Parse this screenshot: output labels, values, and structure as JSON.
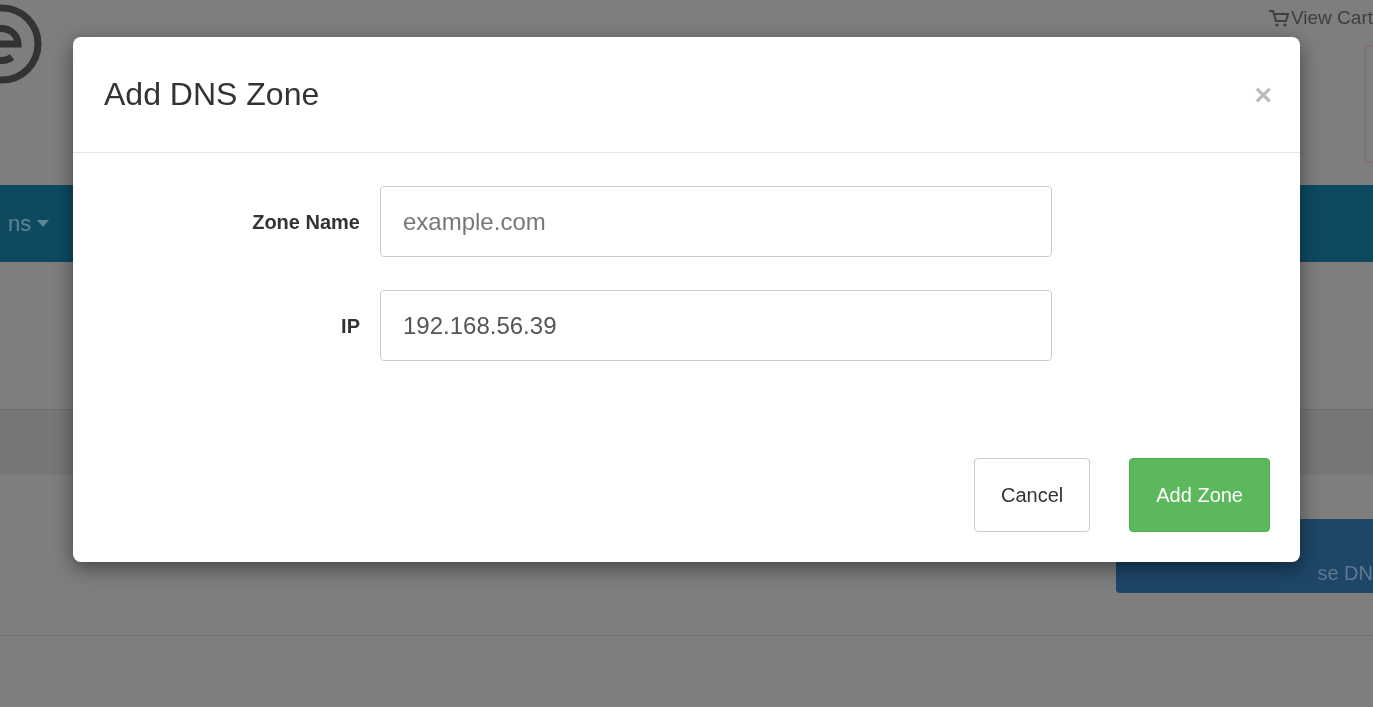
{
  "header": {
    "cart_link": "View Cart"
  },
  "navbar": {
    "menu_label": "ns"
  },
  "page": {
    "action_button": "se DN"
  },
  "modal": {
    "title": "Add DNS Zone",
    "close": "×",
    "fields": [
      {
        "label": "Zone Name",
        "placeholder": "example.com"
      },
      {
        "label": "IP",
        "value": "192.168.56.39"
      }
    ],
    "buttons": [
      {
        "label": "Cancel",
        "kind": "default"
      },
      {
        "label": "Add Zone",
        "kind": "success"
      }
    ]
  }
}
